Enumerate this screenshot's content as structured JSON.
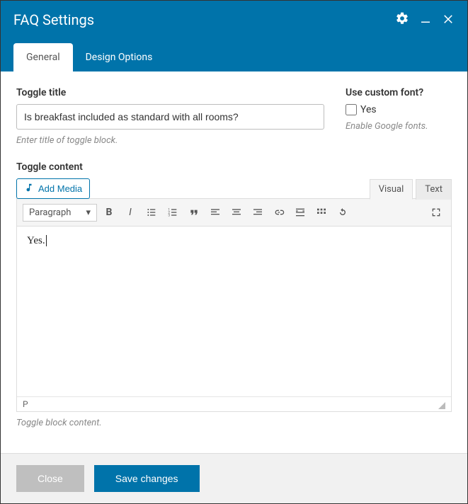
{
  "header": {
    "title": "FAQ Settings"
  },
  "tabs": {
    "general": "General",
    "design": "Design Options"
  },
  "toggle_title": {
    "label": "Toggle title",
    "value": "Is breakfast included as standard with all rooms?",
    "hint": "Enter title of toggle block."
  },
  "custom_font": {
    "label": "Use custom font?",
    "checkbox_label": "Yes",
    "hint": "Enable Google fonts."
  },
  "toggle_content": {
    "label": "Toggle content",
    "add_media": "Add Media",
    "editor_tabs": {
      "visual": "Visual",
      "text": "Text"
    },
    "format": "Paragraph",
    "content": "Yes.",
    "status_path": "P",
    "hint": "Toggle block content."
  },
  "footer": {
    "close": "Close",
    "save": "Save changes"
  }
}
